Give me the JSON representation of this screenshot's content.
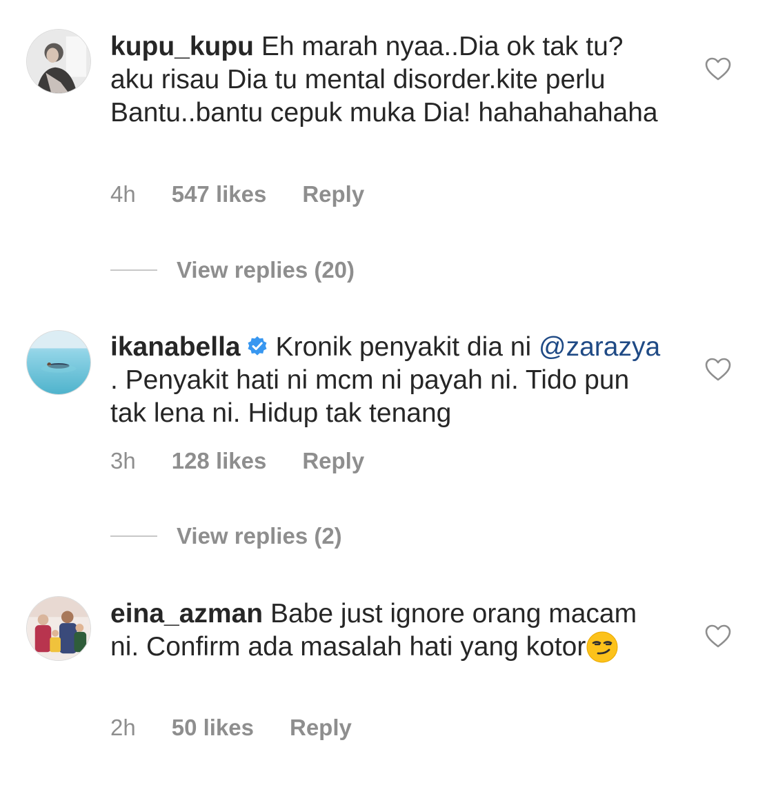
{
  "comments": [
    {
      "username": "kupu_kupu",
      "verified": false,
      "text": "Eh marah nyaa..Dia ok tak tu?aku risau Dia tu mental disorder.kite perlu Bantu..bantu cepuk muka Dia! hahahahahaha",
      "time": "4h",
      "likes": "547 likes",
      "reply": "Reply",
      "view_replies": "View replies (20)",
      "avatar_icon": "user-avatar-woman"
    },
    {
      "username": "ikanabella",
      "verified": true,
      "text_before": "Kronik penyakit dia ni",
      "mention": "@zarazya",
      "text_after": ". Penyakit hati ni mcm ni payah ni. Tido pun tak lena ni. Hidup tak tenang",
      "time": "3h",
      "likes": "128 likes",
      "reply": "Reply",
      "view_replies": "View replies (2)",
      "avatar_icon": "user-avatar-sea"
    },
    {
      "username": "eina_azman",
      "verified": false,
      "text": "Babe just ignore orang macam ni. Confirm ada masalah hati yang kotor",
      "emoji": "smirking-face",
      "time": "2h",
      "likes": "50 likes",
      "reply": "Reply",
      "avatar_icon": "user-avatar-family"
    }
  ],
  "colors": {
    "text": "#262626",
    "meta": "#8e8e8e",
    "mention": "#1f4a85",
    "verified": "#3897f0",
    "divider": "#c7c7c7"
  },
  "icons": {
    "like": "heart-outline-icon",
    "verified": "verified-badge-icon"
  }
}
